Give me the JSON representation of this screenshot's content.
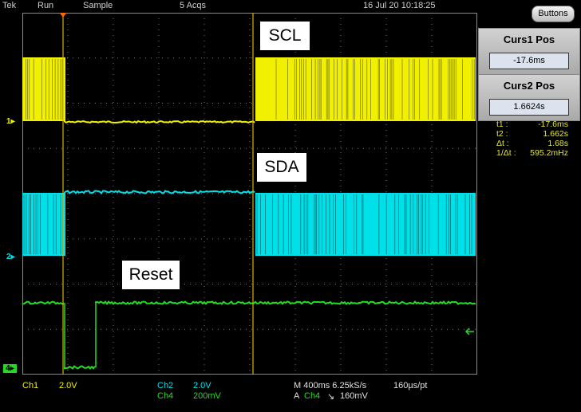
{
  "status": {
    "brand": "Tek",
    "run_state": "Run",
    "acq_mode": "Sample",
    "acq_count": "5 Acqs",
    "datetime": "16 Jul 20 10:18:25"
  },
  "buttons_label": "Buttons",
  "cursor_panel": {
    "curs1": {
      "title": "Curs1 Pos",
      "value": "-17.6ms"
    },
    "curs2": {
      "title": "Curs2 Pos",
      "value": "1.6624s"
    }
  },
  "readouts": [
    {
      "key": "t1 :",
      "value": "-17.6ms"
    },
    {
      "key": "t2 :",
      "value": "1.662s"
    },
    {
      "key": "Δt :",
      "value": "1.68s"
    },
    {
      "key": "1/Δt :",
      "value": "595.2mHz"
    }
  ],
  "channel_labels": {
    "scl": "SCL",
    "sda": "SDA",
    "reset": "Reset"
  },
  "ground_markers": {
    "ch1": "1",
    "ch2": "2",
    "ch4": "4"
  },
  "bottom": {
    "ch1_name": "Ch1",
    "ch1_scale": "2.0V",
    "ch2_name": "Ch2",
    "ch2_scale": "2.0V",
    "ch4_name": "Ch4",
    "ch4_scale": "200mV",
    "timebase": "M 400ms 6.25kS/s",
    "record": "160µs/pt",
    "trigger_prefix": "A",
    "trigger_source": "Ch4",
    "trigger_slope": "↘",
    "trigger_level": "160mV"
  },
  "colors": {
    "ch1": "#f0f000",
    "ch2": "#00e0e8",
    "ch4": "#22dd22",
    "cursor": "#d8b400",
    "grid": "#7a7a7a",
    "trigger_marker": "#ff6a00"
  }
}
